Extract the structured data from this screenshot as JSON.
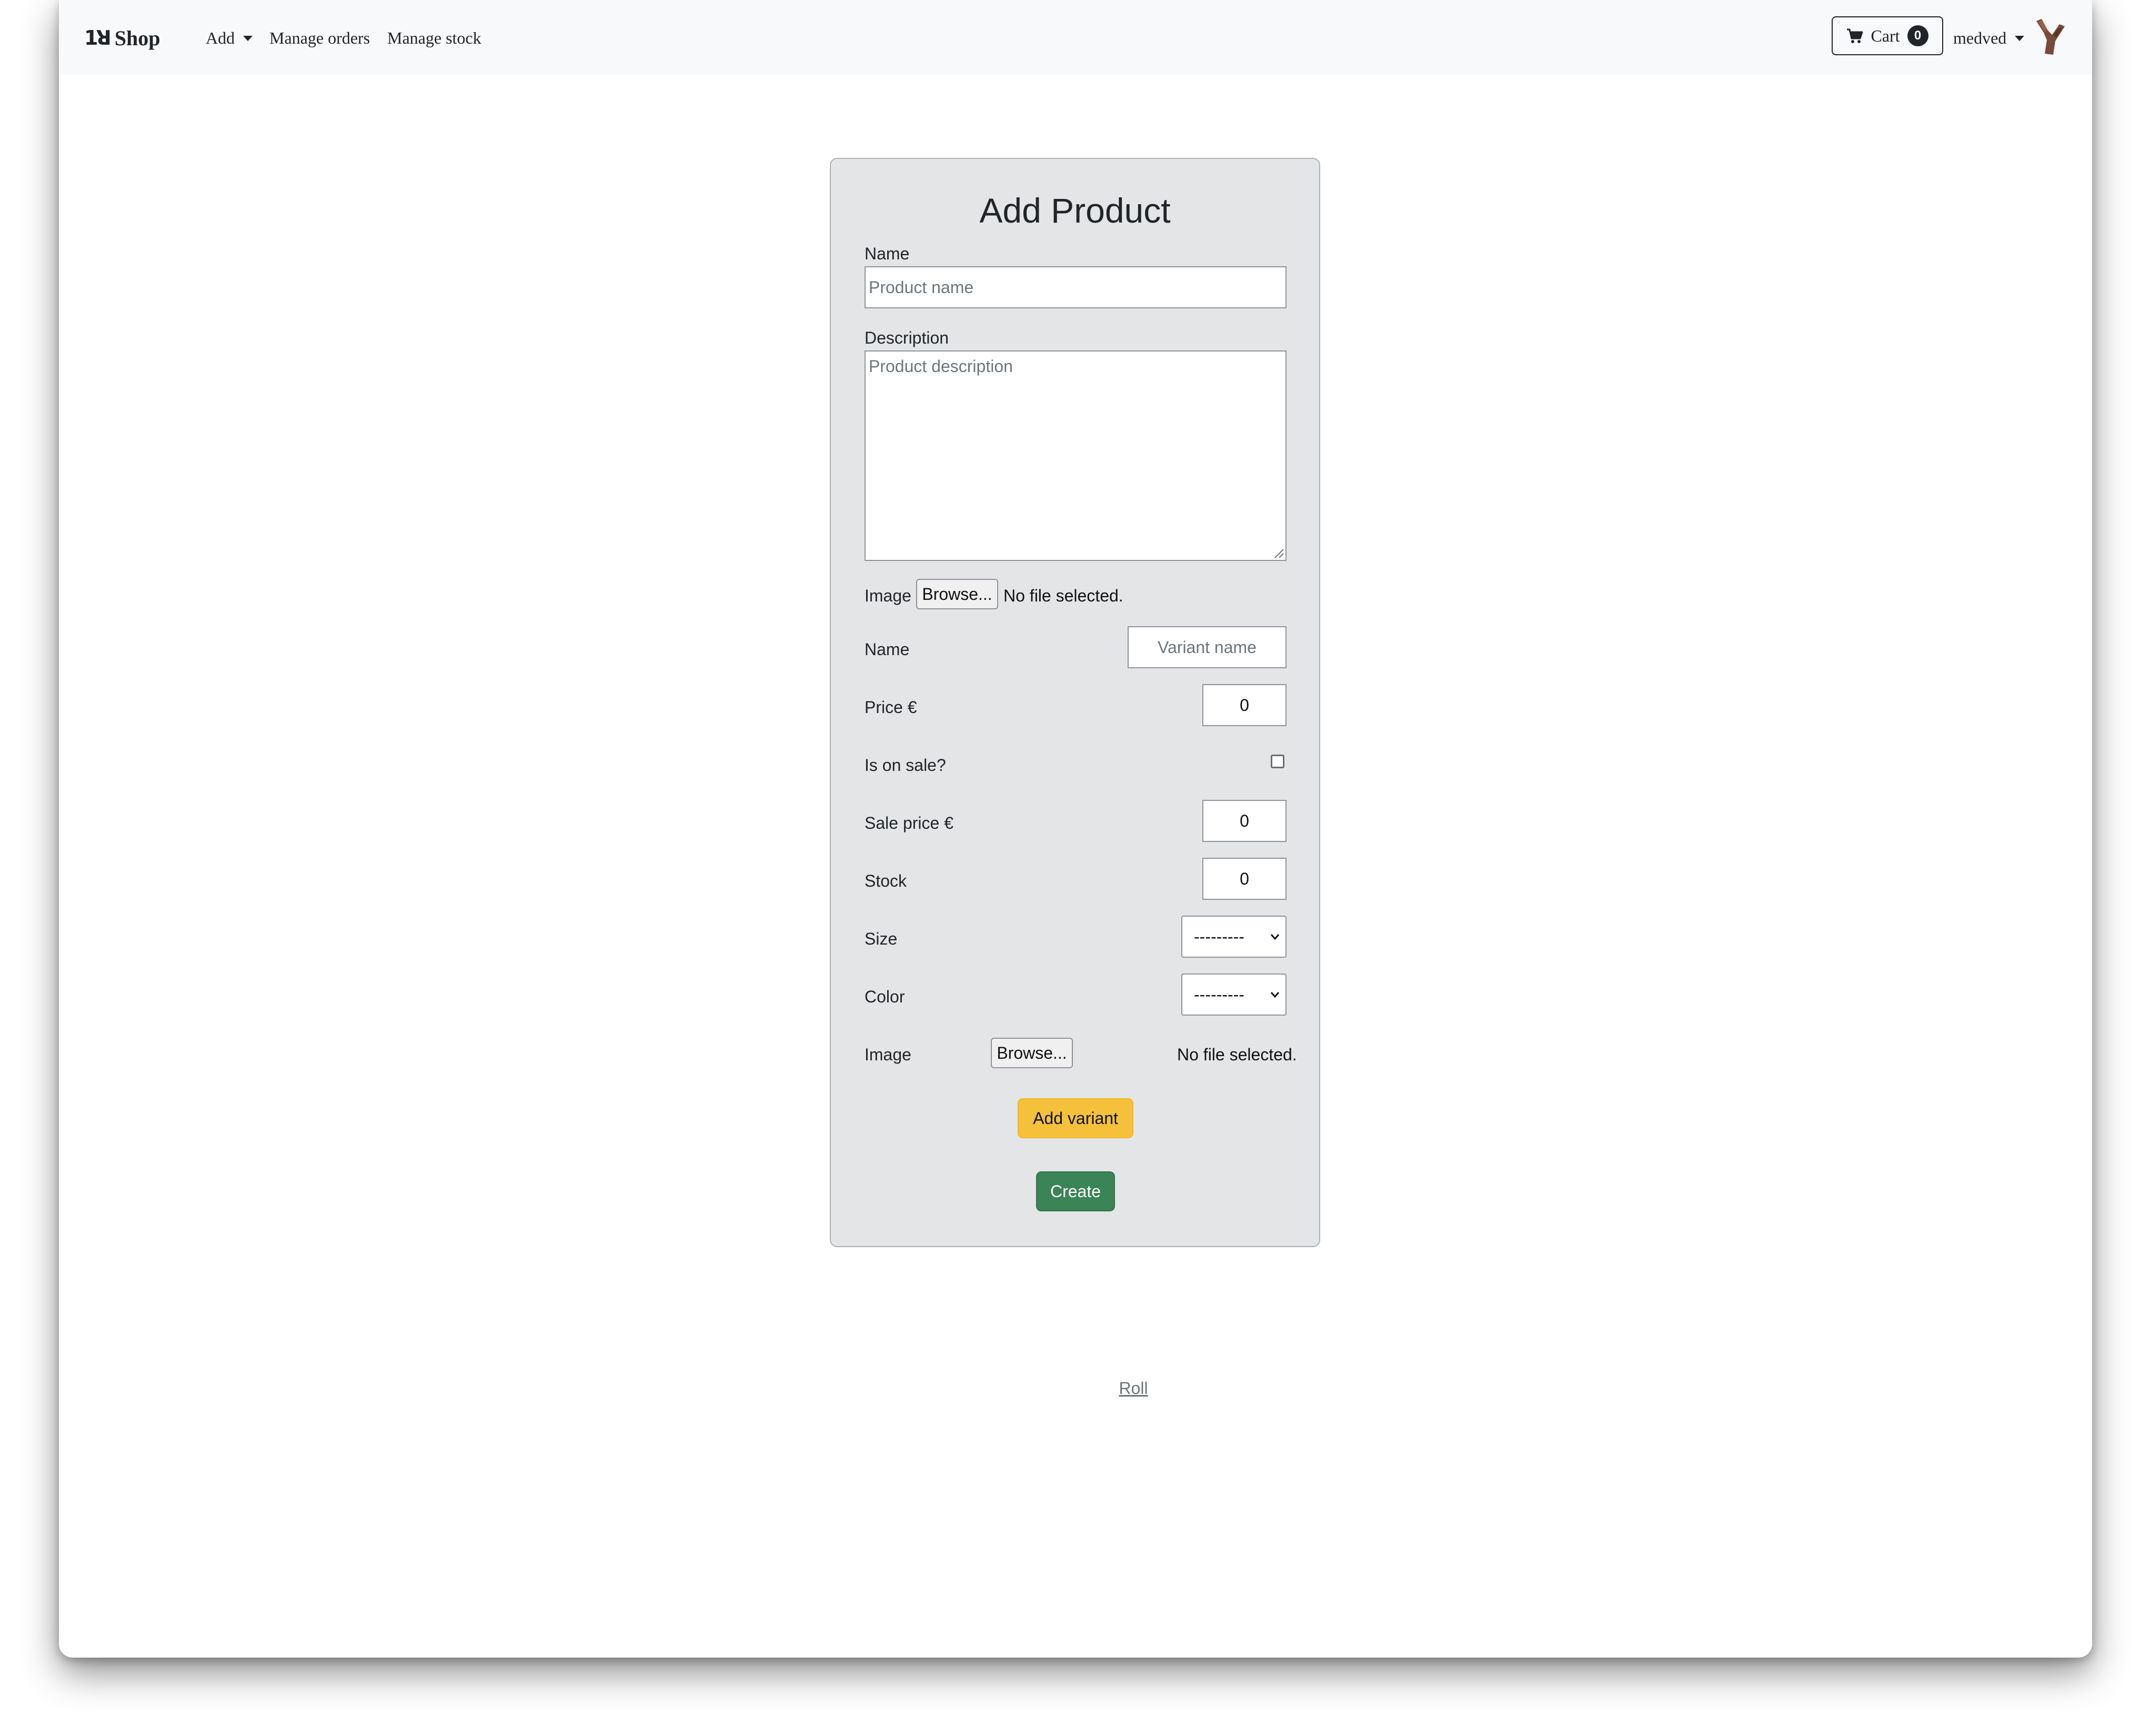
{
  "navbar": {
    "brand_logo": "1ꓤ",
    "brand_name": "Shop",
    "links": {
      "add": "Add",
      "manage_orders": "Manage orders",
      "manage_stock": "Manage stock"
    },
    "cart_label": "Cart",
    "cart_count": "0",
    "username": "medved"
  },
  "form": {
    "title": "Add Product",
    "name_label": "Name",
    "name_placeholder": "Product name",
    "description_label": "Description",
    "description_placeholder": "Product description",
    "image_label": "Image",
    "browse_label": "Browse...",
    "file_status": "No file selected.",
    "variant": {
      "name_label": "Name",
      "name_placeholder": "Variant name",
      "price_label": "Price €",
      "price_value": "0",
      "on_sale_label": "Is on sale?",
      "on_sale_checked": false,
      "sale_price_label": "Sale price €",
      "sale_price_value": "0",
      "stock_label": "Stock",
      "stock_value": "0",
      "size_label": "Size",
      "size_selected": "---------",
      "color_label": "Color",
      "color_selected": "---------",
      "image_label": "Image",
      "browse_label": "Browse...",
      "file_status": "No file selected."
    },
    "add_variant_label": "Add variant",
    "create_label": "Create"
  },
  "footer": {
    "link": "Roll"
  },
  "colors": {
    "add_variant_bg": "#f5c13a",
    "create_bg": "#3a8457",
    "card_bg": "#e4e5e7",
    "navbar_bg": "#f8f9fa"
  }
}
